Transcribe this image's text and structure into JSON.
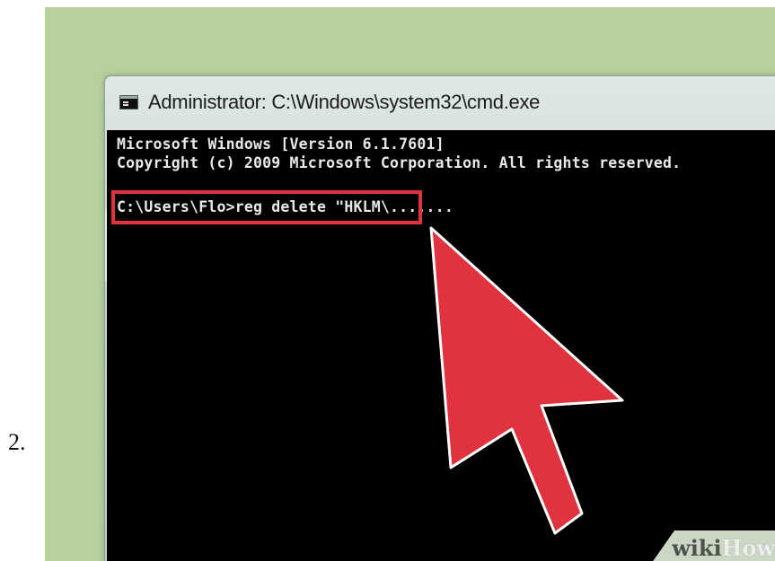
{
  "step": {
    "number": "2."
  },
  "window": {
    "title": "Administrator: C:\\Windows\\system32\\cmd.exe",
    "icon": "cmd-window-icon"
  },
  "console": {
    "lines": [
      "Microsoft Windows [Version 6.1.7601]",
      "Copyright (c) 2009 Microsoft Corporation.  All rights reserved.",
      "C:\\Users\\Flo>reg delete \"HKLM\\......."
    ]
  },
  "annotation": {
    "highlight_color": "#e0333f",
    "arrow_color": "#e0333f"
  },
  "watermark": {
    "part1": "wiki",
    "part2": "How"
  }
}
